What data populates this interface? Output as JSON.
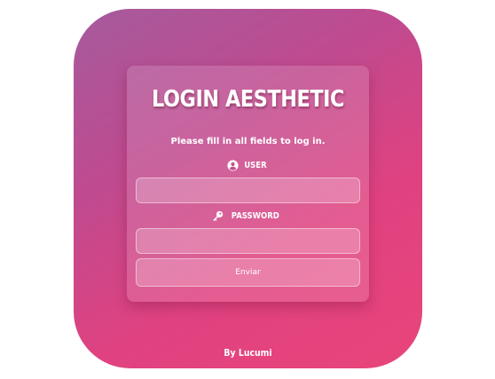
{
  "login": {
    "title": "LOGIN AESTHETIC",
    "subtitle": "Please fill in all fields to log in.",
    "user_label": "USER",
    "user_value": "",
    "password_label": "PASSWORD",
    "password_value": "",
    "submit_label": "Enviar"
  },
  "footer": {
    "credit": "By Lucumi"
  },
  "icons": {
    "user": "user-circle-icon",
    "password": "key-icon"
  },
  "colors": {
    "gradient_start": "#a55b9d",
    "gradient_end": "#e8447a",
    "text": "#ffffff"
  }
}
